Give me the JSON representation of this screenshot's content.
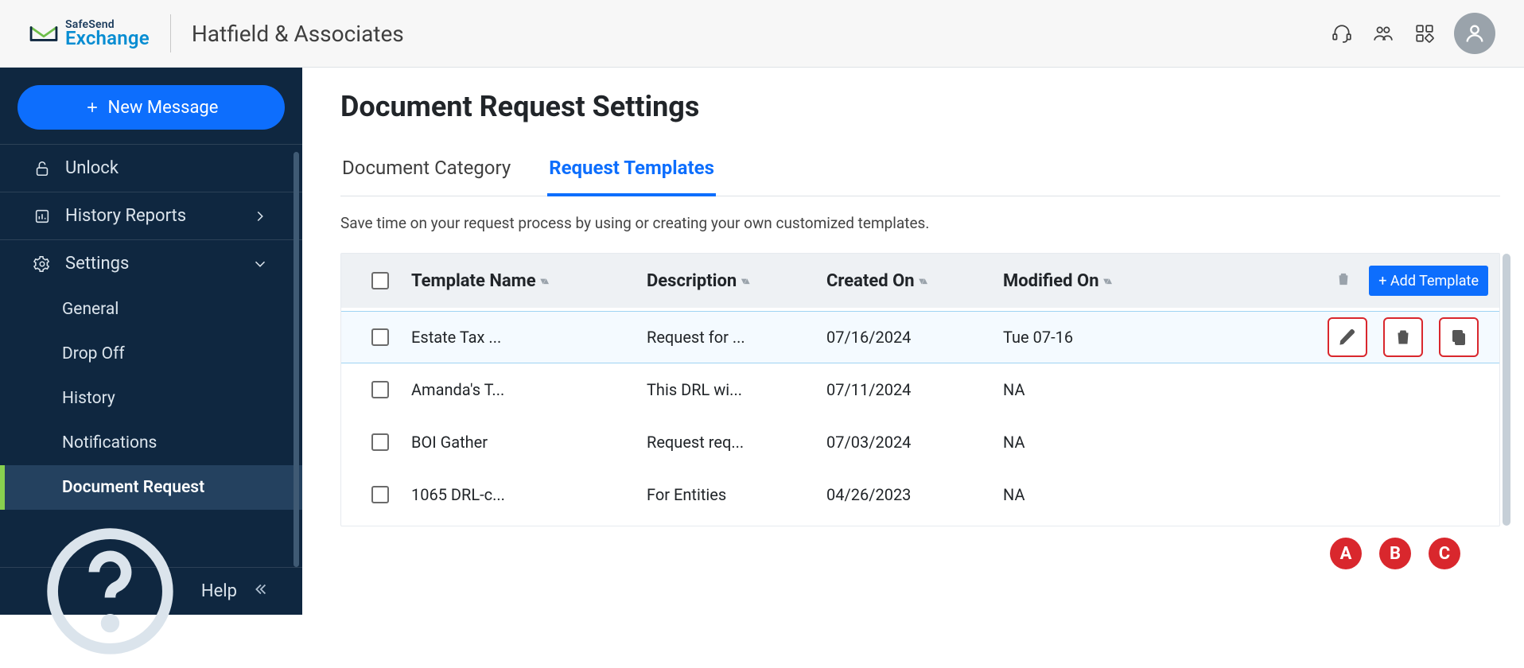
{
  "header": {
    "logo_line1": "SafeSend",
    "logo_line2": "Exchange",
    "org_name": "Hatfield & Associates"
  },
  "sidebar": {
    "new_message_label": "New Message",
    "items": {
      "unlock": "Unlock",
      "history_reports": "History Reports",
      "settings": "Settings",
      "general": "General",
      "drop_off": "Drop Off",
      "history": "History",
      "notifications": "Notifications",
      "document_request": "Document Request",
      "help": "Help"
    }
  },
  "page": {
    "title": "Document Request Settings",
    "tabs": {
      "document_category": "Document Category",
      "request_templates": "Request Templates"
    },
    "description": "Save time on your request process by using or creating your own customized templates.",
    "columns": {
      "template_name": "Template Name",
      "description": "Description",
      "created_on": "Created On",
      "modified_on": "Modified On"
    },
    "add_button": "+ Add Template",
    "rows": [
      {
        "name": "Estate Tax ...",
        "desc": "Request for ...",
        "created": "07/16/2024",
        "modified": "Tue 07-16",
        "selected": true
      },
      {
        "name": "Amanda's T...",
        "desc": "This DRL wi...",
        "created": "07/11/2024",
        "modified": "NA",
        "selected": false
      },
      {
        "name": "BOI Gather",
        "desc": "Request req...",
        "created": "07/03/2024",
        "modified": "NA",
        "selected": false
      },
      {
        "name": "1065 DRL-c...",
        "desc": "For Entities",
        "created": "04/26/2023",
        "modified": "NA",
        "selected": false
      }
    ],
    "annotations": {
      "a": "A",
      "b": "B",
      "c": "C"
    }
  }
}
